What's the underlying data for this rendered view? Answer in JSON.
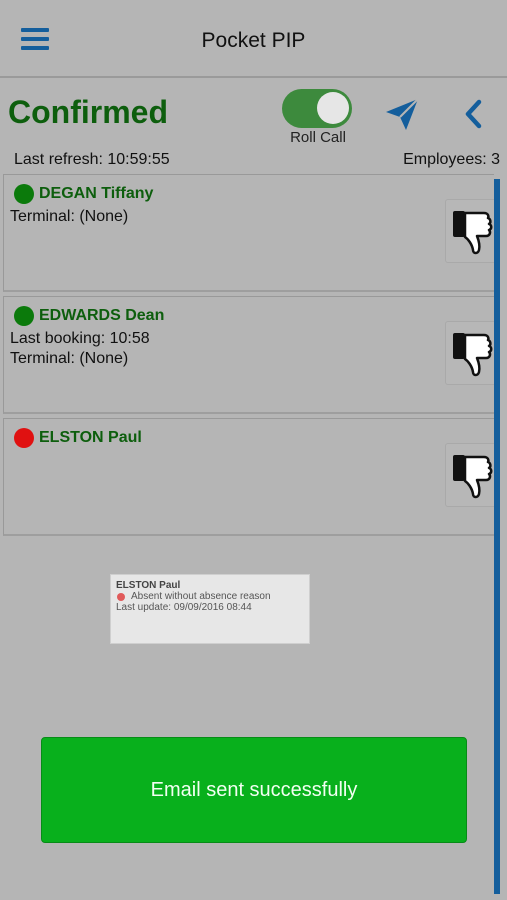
{
  "header": {
    "title": "Pocket PIP"
  },
  "status": {
    "title": "Confirmed",
    "roll_call_label": "Roll Call",
    "roll_call_on": true,
    "last_refresh": "Last refresh: 10:59:55",
    "employees": "Employees: 3"
  },
  "employees": [
    {
      "name": "DEGAN Tiffany",
      "status_color": "#0b7a0b",
      "line1": "Terminal: (None)",
      "line2": ""
    },
    {
      "name": "EDWARDS Dean",
      "status_color": "#0b7a0b",
      "line1": "Last booking: 10:58",
      "line2": "Terminal: (None)"
    },
    {
      "name": "ELSTON Paul",
      "status_color": "#e01111",
      "line1": "",
      "line2": ""
    }
  ],
  "popup": {
    "name": "ELSTON Paul",
    "reason": "Absent without absence reason",
    "last_update": "Last update: 09/09/2016 08:44"
  },
  "toast": {
    "message": "Email sent successfully"
  },
  "colors": {
    "accent": "#145e9c",
    "confirmed_green": "#0d5e0d",
    "toast_green": "#08b01c"
  },
  "icons": [
    "menu-icon",
    "send-icon",
    "back-chevron-icon",
    "thumbs-down-icon"
  ]
}
